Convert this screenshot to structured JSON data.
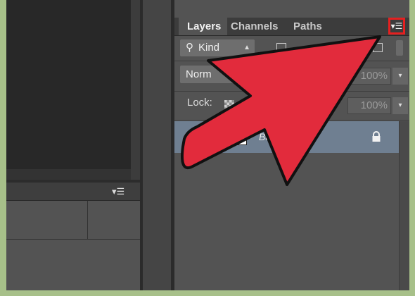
{
  "tabs": [
    {
      "label": "Layers",
      "active": true
    },
    {
      "label": "Channels",
      "active": false
    },
    {
      "label": "Paths",
      "active": false
    }
  ],
  "panel_menu_icon": "panel-menu-icon",
  "filter": {
    "label": "Kind",
    "icon": "search-icon"
  },
  "blend_mode": {
    "value": "Norm"
  },
  "opacity": {
    "value": "100%"
  },
  "lock": {
    "label": "Lock:"
  },
  "fill": {
    "value": "100%"
  },
  "layer": {
    "name": "Ba",
    "lock_icon": "lock-icon"
  },
  "colors": {
    "accent_red": "#e22b3c",
    "highlight_border": "#e52020",
    "layer_selected_bg": "#6f7f91",
    "panel_bg": "#535353",
    "outer_bg": "#a7c089"
  }
}
